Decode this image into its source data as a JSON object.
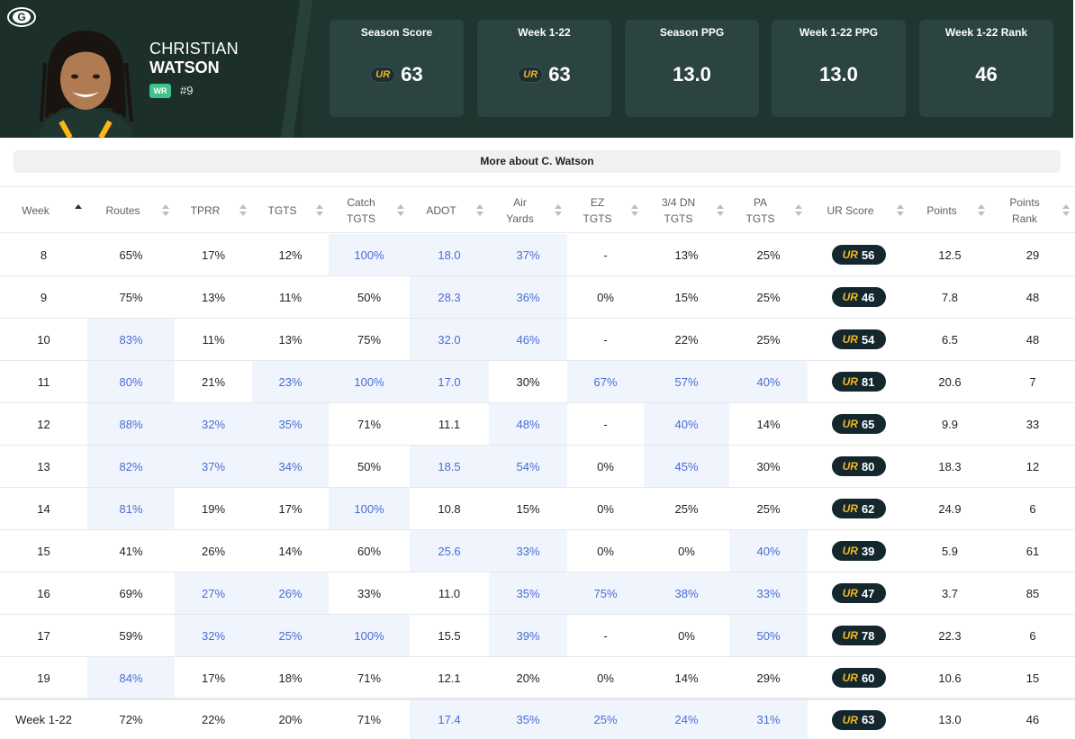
{
  "header": {
    "team_logo_icon": "packers-g-logo-icon",
    "player_first": "CHRISTIAN",
    "player_last": "WATSON",
    "position": "WR",
    "jersey": "#9",
    "stats": [
      {
        "label": "Season Score",
        "value": "63",
        "ur_logo": true
      },
      {
        "label": "Week 1-22",
        "value": "63",
        "ur_logo": true
      },
      {
        "label": "Season PPG",
        "value": "13.0",
        "ur_logo": false
      },
      {
        "label": "Week 1-22 PPG",
        "value": "13.0",
        "ur_logo": false
      },
      {
        "label": "Week 1-22 Rank",
        "value": "46",
        "ur_logo": false
      }
    ]
  },
  "more_button": "More about C. Watson",
  "ur_mark": "UR",
  "columns": [
    "Week",
    "Routes",
    "TPRR",
    "TGTS",
    "Catch TGTS",
    "ADOT",
    "Air Yards",
    "EZ TGTS",
    "3/4 DN TGTS",
    "PA TGTS",
    "UR Score",
    "Points",
    "Points Rank"
  ],
  "column_lines": [
    [
      "Week"
    ],
    [
      "Routes"
    ],
    [
      "TPRR"
    ],
    [
      "TGTS"
    ],
    [
      "Catch",
      "TGTS"
    ],
    [
      "ADOT"
    ],
    [
      "Air",
      "Yards"
    ],
    [
      "EZ",
      "TGTS"
    ],
    [
      "3/4 DN",
      "TGTS"
    ],
    [
      "PA",
      "TGTS"
    ],
    [
      "UR Score"
    ],
    [
      "Points"
    ],
    [
      "Points",
      "Rank"
    ]
  ],
  "rows": [
    {
      "week": "8",
      "routes": "65%",
      "tprr": "17%",
      "tgts": "12%",
      "catch": "100%",
      "adot": "18.0",
      "air": "37%",
      "ez": "-",
      "dn": "13%",
      "pa": "25%",
      "ur": "56",
      "points": "12.5",
      "rank": "29",
      "hl": [
        false,
        false,
        false,
        false,
        true,
        true,
        true,
        false,
        false,
        false
      ]
    },
    {
      "week": "9",
      "routes": "75%",
      "tprr": "13%",
      "tgts": "11%",
      "catch": "50%",
      "adot": "28.3",
      "air": "36%",
      "ez": "0%",
      "dn": "15%",
      "pa": "25%",
      "ur": "46",
      "points": "7.8",
      "rank": "48",
      "hl": [
        false,
        false,
        false,
        false,
        false,
        true,
        true,
        false,
        false,
        false
      ]
    },
    {
      "week": "10",
      "routes": "83%",
      "tprr": "11%",
      "tgts": "13%",
      "catch": "75%",
      "adot": "32.0",
      "air": "46%",
      "ez": "-",
      "dn": "22%",
      "pa": "25%",
      "ur": "54",
      "points": "6.5",
      "rank": "48",
      "hl": [
        false,
        true,
        false,
        false,
        false,
        true,
        true,
        false,
        false,
        false
      ]
    },
    {
      "week": "11",
      "routes": "80%",
      "tprr": "21%",
      "tgts": "23%",
      "catch": "100%",
      "adot": "17.0",
      "air": "30%",
      "ez": "67%",
      "dn": "57%",
      "pa": "40%",
      "ur": "81",
      "points": "20.6",
      "rank": "7",
      "hl": [
        false,
        true,
        false,
        true,
        true,
        true,
        false,
        true,
        true,
        true
      ]
    },
    {
      "week": "12",
      "routes": "88%",
      "tprr": "32%",
      "tgts": "35%",
      "catch": "71%",
      "adot": "11.1",
      "air": "48%",
      "ez": "-",
      "dn": "40%",
      "pa": "14%",
      "ur": "65",
      "points": "9.9",
      "rank": "33",
      "hl": [
        false,
        true,
        true,
        true,
        false,
        false,
        true,
        false,
        true,
        false
      ]
    },
    {
      "week": "13",
      "routes": "82%",
      "tprr": "37%",
      "tgts": "34%",
      "catch": "50%",
      "adot": "18.5",
      "air": "54%",
      "ez": "0%",
      "dn": "45%",
      "pa": "30%",
      "ur": "80",
      "points": "18.3",
      "rank": "12",
      "hl": [
        false,
        true,
        true,
        true,
        false,
        true,
        true,
        false,
        true,
        false
      ]
    },
    {
      "week": "14",
      "routes": "81%",
      "tprr": "19%",
      "tgts": "17%",
      "catch": "100%",
      "adot": "10.8",
      "air": "15%",
      "ez": "0%",
      "dn": "25%",
      "pa": "25%",
      "ur": "62",
      "points": "24.9",
      "rank": "6",
      "hl": [
        false,
        true,
        false,
        false,
        true,
        false,
        false,
        false,
        false,
        false
      ]
    },
    {
      "week": "15",
      "routes": "41%",
      "tprr": "26%",
      "tgts": "14%",
      "catch": "60%",
      "adot": "25.6",
      "air": "33%",
      "ez": "0%",
      "dn": "0%",
      "pa": "40%",
      "ur": "39",
      "points": "5.9",
      "rank": "61",
      "hl": [
        false,
        false,
        false,
        false,
        false,
        true,
        true,
        false,
        false,
        true
      ]
    },
    {
      "week": "16",
      "routes": "69%",
      "tprr": "27%",
      "tgts": "26%",
      "catch": "33%",
      "adot": "11.0",
      "air": "35%",
      "ez": "75%",
      "dn": "38%",
      "pa": "33%",
      "ur": "47",
      "points": "3.7",
      "rank": "85",
      "hl": [
        false,
        false,
        true,
        true,
        false,
        false,
        true,
        true,
        true,
        true
      ]
    },
    {
      "week": "17",
      "routes": "59%",
      "tprr": "32%",
      "tgts": "25%",
      "catch": "100%",
      "adot": "15.5",
      "air": "39%",
      "ez": "-",
      "dn": "0%",
      "pa": "50%",
      "ur": "78",
      "points": "22.3",
      "rank": "6",
      "hl": [
        false,
        false,
        true,
        true,
        true,
        false,
        true,
        false,
        false,
        true
      ]
    },
    {
      "week": "19",
      "routes": "84%",
      "tprr": "17%",
      "tgts": "18%",
      "catch": "71%",
      "adot": "12.1",
      "air": "20%",
      "ez": "0%",
      "dn": "14%",
      "pa": "29%",
      "ur": "60",
      "points": "10.6",
      "rank": "15",
      "hl": [
        false,
        true,
        false,
        false,
        false,
        false,
        false,
        false,
        false,
        false
      ]
    }
  ],
  "total": {
    "week": "Week 1-22",
    "routes": "72%",
    "tprr": "22%",
    "tgts": "20%",
    "catch": "71%",
    "adot": "17.4",
    "air": "35%",
    "ez": "25%",
    "dn": "24%",
    "pa": "31%",
    "ur": "63",
    "points": "13.0",
    "rank": "46",
    "hl": [
      false,
      false,
      false,
      false,
      false,
      true,
      true,
      true,
      true,
      true
    ]
  },
  "colors": {
    "header_bg": "#1c2f2a",
    "card_bg": "#2c4440",
    "highlight_bg": "#f0f5fd",
    "highlight_text": "#4a6bd4",
    "ur_gold": "#f2b81f",
    "pos_green": "#3cc48a"
  }
}
